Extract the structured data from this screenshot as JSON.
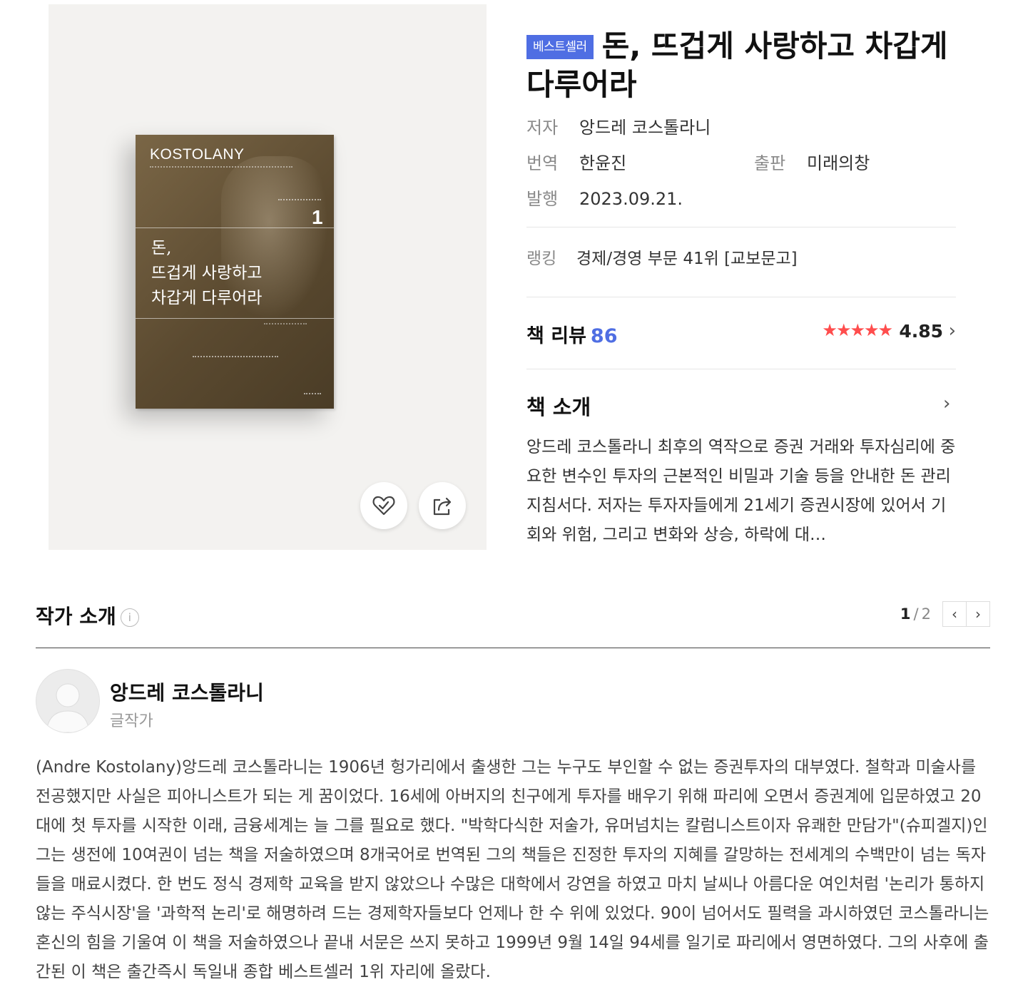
{
  "book": {
    "cover": {
      "brand": "KOSTOLANY",
      "number": "1",
      "title": "돈,\n뜨겁게 사랑하고\n차갑게 다루어라"
    },
    "badge": "베스트셀러",
    "title": "돈, 뜨겁게 사랑하고 차갑게 다루어라",
    "meta": {
      "author_label": "저자",
      "author": "앙드레 코스톨라니",
      "translator_label": "번역",
      "translator": "한윤진",
      "publisher_label": "출판",
      "publisher": "미래의창",
      "date_label": "발행",
      "date": "2023.09.21."
    },
    "ranking": {
      "label": "랭킹",
      "value": "경제/경영 부문 41위 [교보문고]"
    },
    "review": {
      "label": "책 리뷰",
      "count": "86",
      "stars": "★★★★★",
      "rating": "4.85",
      "rating_value": 4.85
    },
    "intro": {
      "label": "책 소개",
      "text": "앙드레 코스톨라니 최후의 역작으로 증권 거래와 투자심리에 중요한 변수인 투자의 근본적인 비밀과 기술 등을 안내한 돈 관리 지침서다. 저자는 투자자들에게 21세기 증권시장에 있어서 기회와 위험, 그리고 변화와 상승, 하락에 대…"
    }
  },
  "author_section": {
    "heading": "작가 소개",
    "info_icon": "i",
    "pager": {
      "current": "1",
      "separator": "/",
      "total": "2"
    },
    "name": "앙드레 코스톨라니",
    "role": "글작가",
    "bio": "(Andre Kostolany)앙드레 코스톨라니는 1906년 헝가리에서 출생한 그는 누구도 부인할 수 없는 증권투자의 대부였다. 철학과 미술사를 전공했지만 사실은 피아니스트가 되는 게 꿈이었다. 16세에 아버지의 친구에게 투자를 배우기 위해 파리에 오면서 증권계에 입문하였고 20대에 첫 투자를 시작한 이래, 금융세계는 늘 그를 필요로 했다. \"박학다식한 저술가, 유머넘치는 칼럼니스트이자 유쾌한 만담가\"(슈피겔지)인 그는 생전에 10여권이 넘는 책을 저술하였으며 8개국어로 번역된 그의 책들은 진정한 투자의 지혜를 갈망하는 전세계의 수백만이 넘는 독자들을 매료시켰다. 한 번도 정식 경제학 교육을 받지 않았으나 수많은 대학에서 강연을 하였고 마치 날씨나 아름다운 여인처럼 '논리가 통하지 않는 주식시장'을 '과학적 논리'로 해명하려 드는 경제학자들보다 언제나 한 수 위에 있었다. 90이 넘어서도 필력을 과시하였던 코스톨라니는 혼신의 힘을 기울여 이 책을 저술하였으나 끝내 서문은 쓰지 못하고 1999년 9월 14일 94세를 일기로 파리에서 영면하였다. 그의 사후에 출간된 이 책은 출간즉시 독일내 종합 베스트셀러 1위 자리에 올랐다."
  },
  "icons": {
    "like": "heart-check-icon",
    "share": "share-icon",
    "chevron_right": "chevron-right-icon",
    "chevron_left": "chevron-left-icon",
    "avatar": "person-avatar-icon"
  },
  "colors": {
    "badge": "#4f6ee3",
    "review_count": "#4f6ee3",
    "stars": "#ff4d4d",
    "cover_panel": "#f3f2f0"
  }
}
